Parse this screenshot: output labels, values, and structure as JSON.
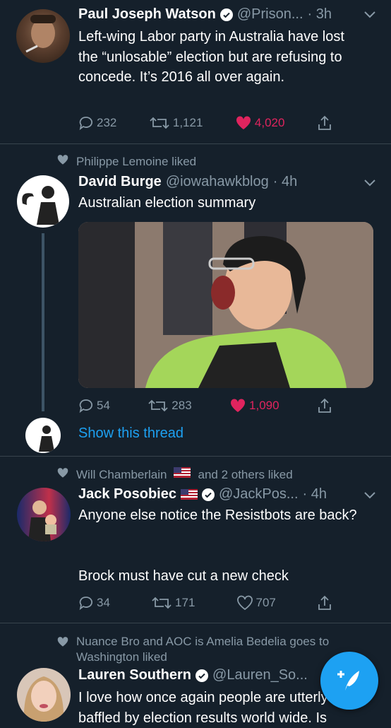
{
  "tweets": [
    {
      "name": "Paul Joseph Watson",
      "handle": "@Prison...",
      "time": "· 3h",
      "text": "Left-wing Labor party in Australia have lost the “unlosable” election but are refusing to concede. It’s 2016 all over again.",
      "replies": "232",
      "retweets": "1,121",
      "likes": "4,020"
    },
    {
      "context": "Philippe Lemoine liked",
      "name": "David Burge",
      "handle": "@iowahawkblog",
      "time": "· 4h",
      "text": "Australian election summary",
      "replies": "54",
      "retweets": "283",
      "likes": "1,090",
      "thread_link": "Show this thread"
    },
    {
      "context_name": "Will Chamberlain",
      "context_rest": "and 2 others liked",
      "name": "Jack Posobiec",
      "handle": "@JackPos...",
      "time": "· 4h",
      "text1": "Anyone else notice the Resistbots are back?",
      "text2": "Brock must have cut a new check",
      "replies": "34",
      "retweets": "171",
      "likes": "707"
    },
    {
      "context": "Nuance Bro and AOC is Amelia Bedelia goes to Washington liked",
      "name": "Lauren Southern",
      "handle": "@Lauren_So...",
      "text": "I love how once again people are utterly baffled by election results world wide. Is"
    }
  ],
  "colors": {
    "background": "#15202b",
    "accent": "#1da1f2",
    "like": "#e0245e",
    "muted": "#8899a6"
  },
  "icons": {
    "reply": "reply-icon",
    "retweet": "retweet-icon",
    "like": "heart-icon",
    "share": "share-icon",
    "compose": "compose-tweet-icon"
  }
}
